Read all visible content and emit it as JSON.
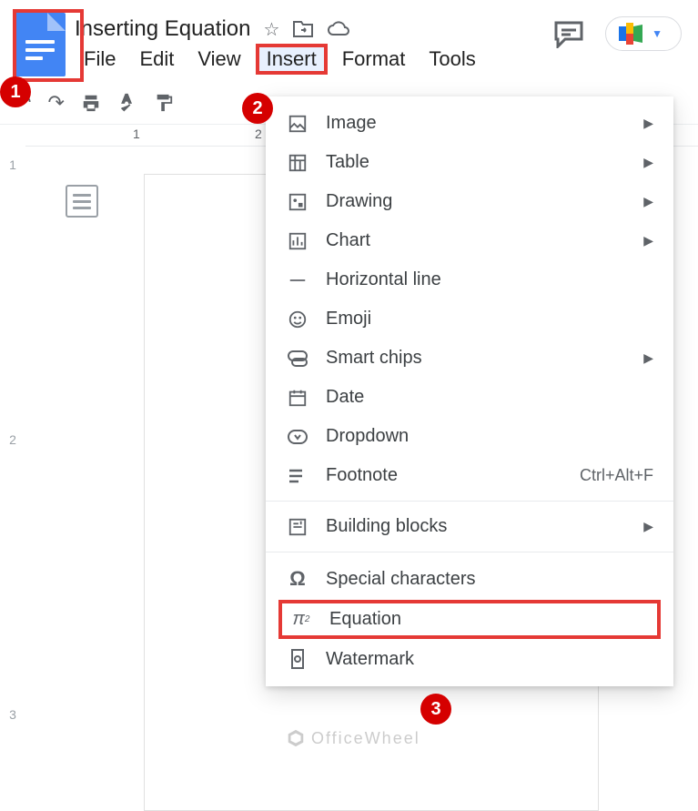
{
  "title": "Inserting Equation",
  "menubar": {
    "file": "File",
    "edit": "Edit",
    "view": "View",
    "insert": "Insert",
    "format": "Format",
    "tools": "Tools"
  },
  "ruler": {
    "n1": "1",
    "n2": "2"
  },
  "left_ruler": {
    "n1": "1",
    "n2": "2",
    "n3": "3"
  },
  "insert_menu": {
    "image": "Image",
    "table": "Table",
    "drawing": "Drawing",
    "chart": "Chart",
    "hline": "Horizontal line",
    "emoji": "Emoji",
    "smartchips": "Smart chips",
    "date": "Date",
    "dropdown": "Dropdown",
    "footnote": "Footnote",
    "footnote_shortcut": "Ctrl+Alt+F",
    "building_blocks": "Building blocks",
    "special_chars": "Special characters",
    "equation": "Equation",
    "watermark": "Watermark"
  },
  "callouts": {
    "c1": "1",
    "c2": "2",
    "c3": "3"
  },
  "watermark_text": "OfficeWheel"
}
